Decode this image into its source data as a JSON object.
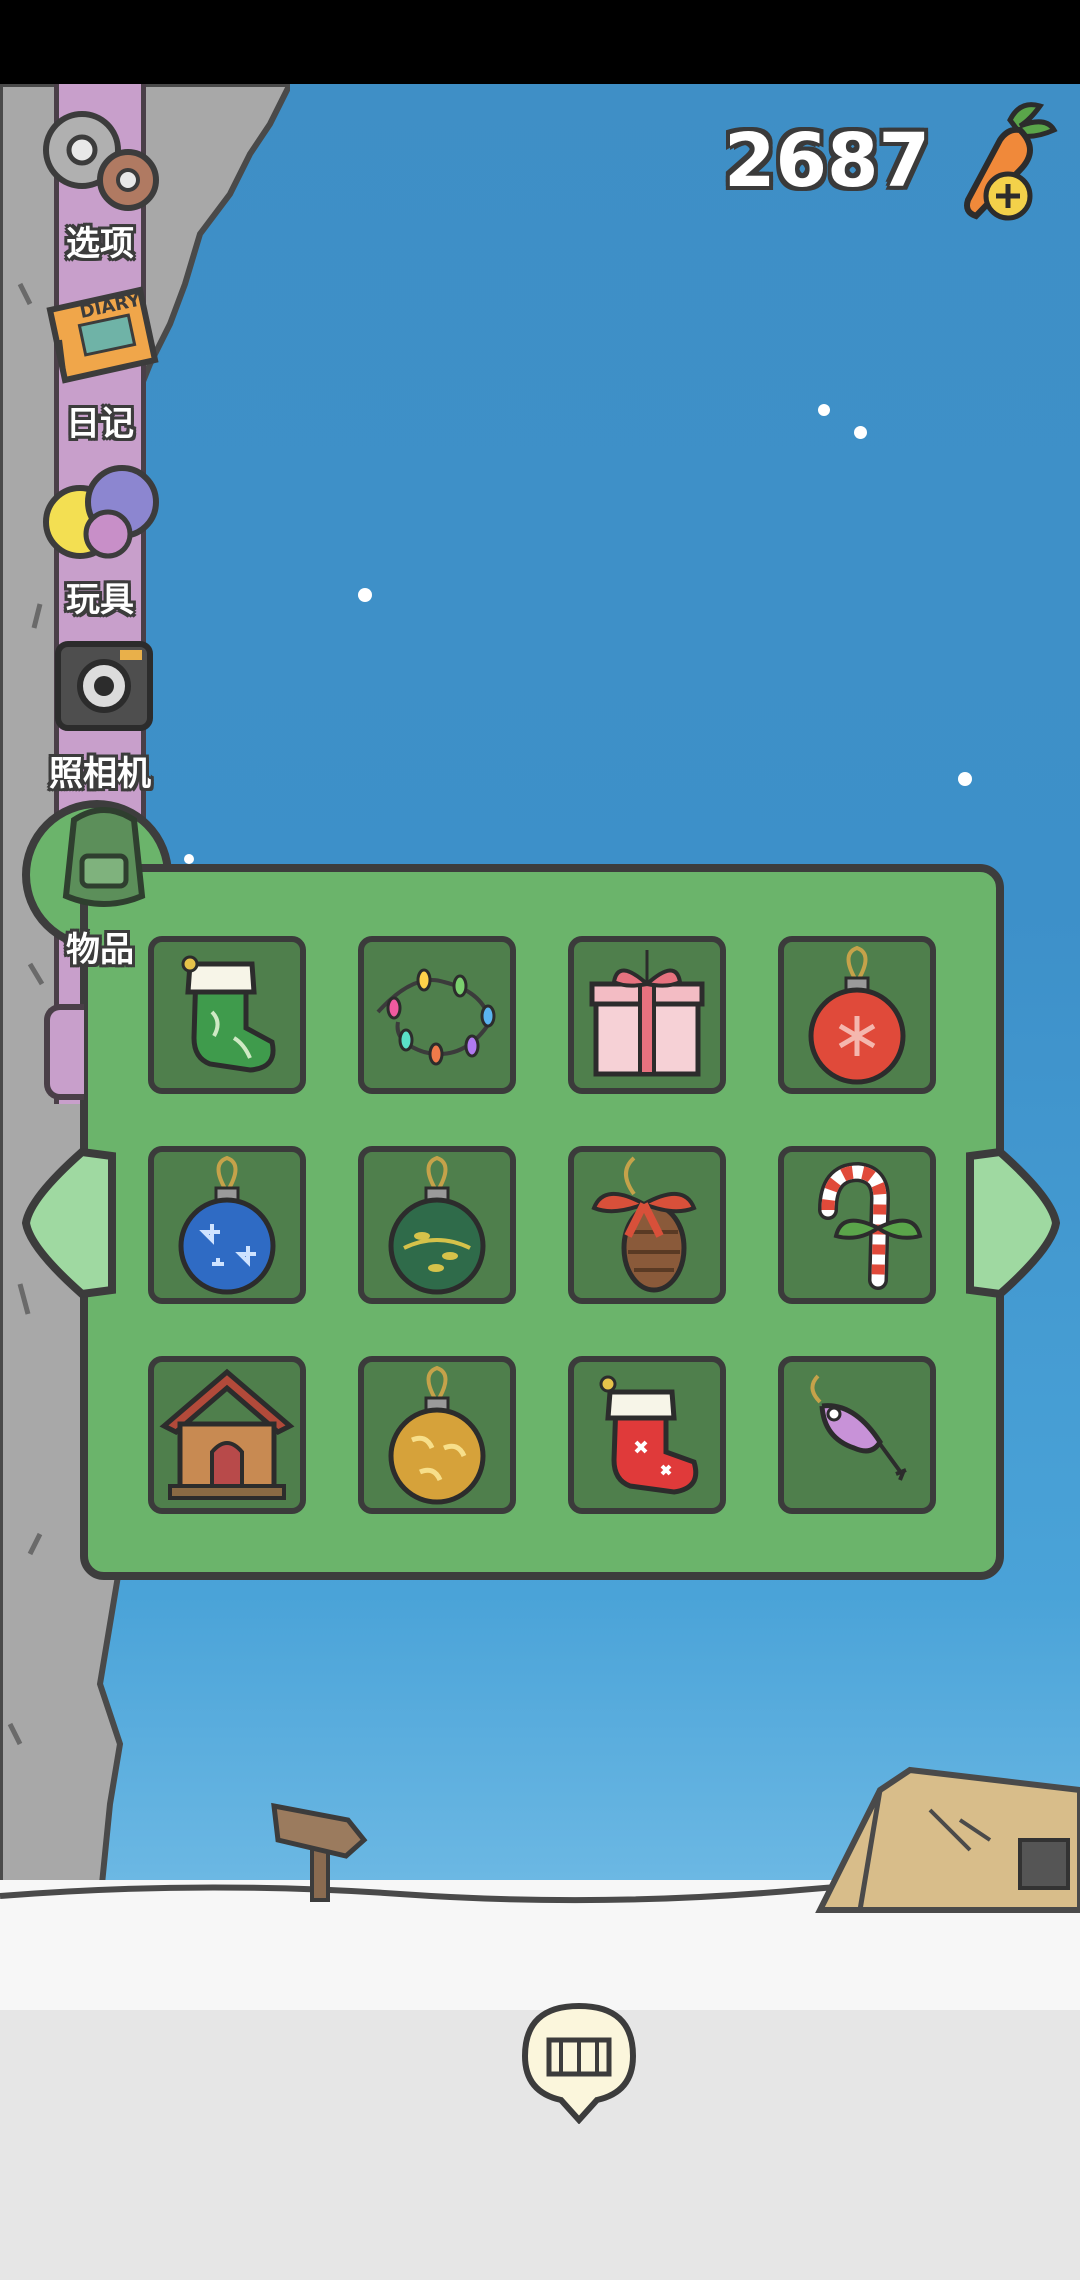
{
  "status_bar": {},
  "currency": {
    "carrot_count": "2687",
    "icon": "carrot-plus-icon"
  },
  "menu": {
    "items": [
      {
        "label": "选项",
        "icon": "gear-icon"
      },
      {
        "label": "日记",
        "icon": "diary-icon",
        "book_text": "DIARY"
      },
      {
        "label": "玩具",
        "icon": "toy-balls-icon"
      },
      {
        "label": "照相机",
        "icon": "camera-icon"
      },
      {
        "label": "物品",
        "icon": "backpack-icon"
      }
    ]
  },
  "inventory": {
    "items": [
      {
        "name": "green-stocking",
        "icon": "green-stocking-icon"
      },
      {
        "name": "string-lights",
        "icon": "string-lights-icon"
      },
      {
        "name": "gift-box",
        "icon": "gift-box-icon"
      },
      {
        "name": "red-ornament",
        "icon": "red-ornament-icon"
      },
      {
        "name": "blue-ornament",
        "icon": "blue-ornament-icon"
      },
      {
        "name": "green-ornament",
        "icon": "green-ornament-icon"
      },
      {
        "name": "pinecone-bow",
        "icon": "pinecone-icon"
      },
      {
        "name": "candy-cane",
        "icon": "candy-cane-icon"
      },
      {
        "name": "tiny-house",
        "icon": "house-icon"
      },
      {
        "name": "gold-ornament",
        "icon": "gold-ornament-icon"
      },
      {
        "name": "red-stocking",
        "icon": "red-stocking-icon"
      },
      {
        "name": "fishing-lure",
        "icon": "fishing-lure-icon"
      }
    ]
  },
  "colors": {
    "panel_green": "#6bb46b",
    "slot_green": "#4f7f4c",
    "sky_blue": "#3f8fc6",
    "sidebar_purple": "#c89fcb"
  }
}
